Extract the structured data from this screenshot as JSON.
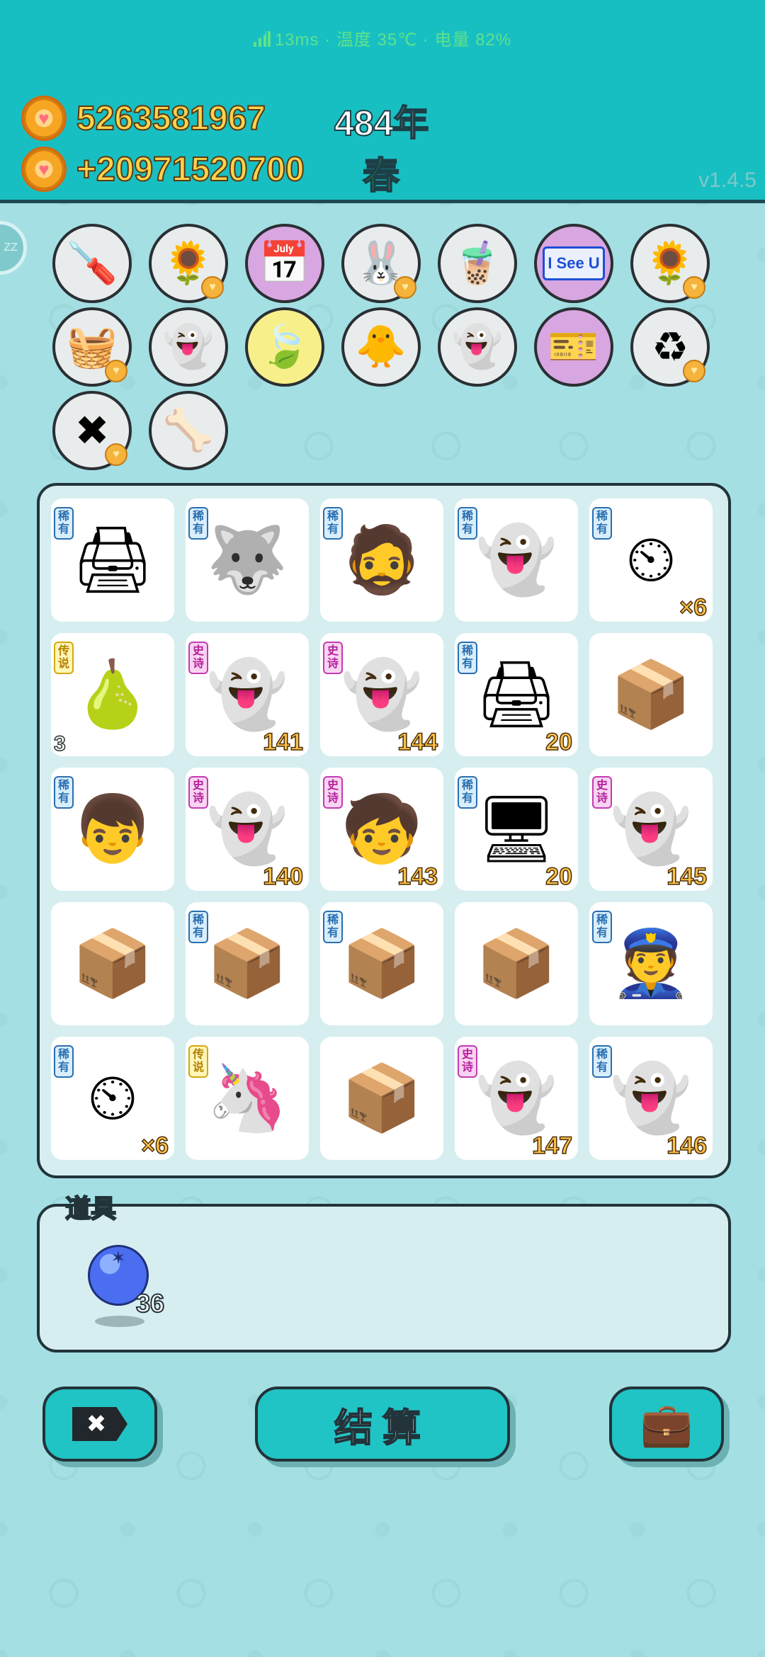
{
  "status": {
    "text": "13ms · 温度 35℃ · 电量 82%"
  },
  "header": {
    "coins": "5263581967",
    "income": "+20971520700",
    "year": "484年",
    "season": "春",
    "version": "v1.4.5"
  },
  "side_badge": {
    "text": "ZZ"
  },
  "colors": {
    "header": "#18bfc2",
    "accent_gold": "#ffc24a",
    "board_bg": "#d6eef0"
  },
  "strip_items": [
    {
      "icon": "screwdriver-icon",
      "glyph": "🪛",
      "style": "grey",
      "heart": false
    },
    {
      "icon": "sunflower-pair-icon",
      "glyph": "🌻",
      "style": "grey",
      "heart": true
    },
    {
      "icon": "calendar-icon",
      "glyph": "📅",
      "style": "purple",
      "heart": false
    },
    {
      "icon": "rabbit-icon",
      "glyph": "🐰",
      "style": "grey",
      "heart": true
    },
    {
      "icon": "bubble-tea-icon",
      "glyph": "🧋",
      "style": "grey",
      "heart": false
    },
    {
      "icon": "i-see-u-icon",
      "glyph": "I See U",
      "style": "purple",
      "heart": false
    },
    {
      "icon": "sunflower-pair-icon",
      "glyph": "🌻",
      "style": "grey",
      "heart": true
    },
    {
      "icon": "fruit-basket-icon",
      "glyph": "🧺",
      "style": "grey",
      "heart": true
    },
    {
      "icon": "ghost-wink-icon",
      "glyph": "👻",
      "style": "grey",
      "heart": false
    },
    {
      "icon": "leaf-icon",
      "glyph": "🍃",
      "style": "yellow",
      "heart": false
    },
    {
      "icon": "chick-egg-icon",
      "glyph": "🐥",
      "style": "grey",
      "heart": false
    },
    {
      "icon": "ghost-wink-icon",
      "glyph": "👻",
      "style": "grey",
      "heart": false
    },
    {
      "icon": "capsule-pack-icon",
      "glyph": "🎫",
      "style": "purple",
      "heart": false
    },
    {
      "icon": "recycle-icon",
      "glyph": "♻",
      "style": "grey",
      "heart": true
    },
    {
      "icon": "remove-tag-icon",
      "glyph": "✖",
      "style": "grey",
      "heart": true
    },
    {
      "icon": "pet-food-bowl-icon",
      "glyph": "🦴",
      "style": "grey",
      "heart": false
    }
  ],
  "rarity_labels": {
    "rare": "稀有",
    "legend": "传说",
    "epic": "史诗"
  },
  "board": [
    {
      "icon": "printer-icon",
      "glyph": "🖨",
      "rarity": "稀有",
      "rarity_kind": "rare",
      "count": ""
    },
    {
      "icon": "husky-dog-icon",
      "glyph": "🐺",
      "rarity": "稀有",
      "rarity_kind": "rare",
      "count": ""
    },
    {
      "icon": "bucket-hat-man-icon",
      "glyph": "🧔",
      "rarity": "稀有",
      "rarity_kind": "rare",
      "count": ""
    },
    {
      "icon": "ghost-x-eyes-icon",
      "glyph": "👻",
      "rarity": "稀有",
      "rarity_kind": "rare",
      "count": ""
    },
    {
      "icon": "speedometer-icon",
      "glyph": "⏲",
      "rarity": "稀有",
      "rarity_kind": "rare",
      "count": "×6"
    },
    {
      "icon": "pear-icon",
      "glyph": "🍐",
      "rarity": "传说",
      "rarity_kind": "legend",
      "count": "",
      "count_left": "3"
    },
    {
      "icon": "ghost-x-eyes-icon",
      "glyph": "👻",
      "rarity": "史诗",
      "rarity_kind": "epic",
      "count": "141"
    },
    {
      "icon": "ghost-x-eyes-icon",
      "glyph": "👻",
      "rarity": "史诗",
      "rarity_kind": "epic",
      "count": "144"
    },
    {
      "icon": "printer-icon",
      "glyph": "🖨",
      "rarity": "稀有",
      "rarity_kind": "rare",
      "count": "20"
    },
    {
      "icon": "cardboard-box-icon",
      "glyph": "📦",
      "rarity": "",
      "rarity_kind": "",
      "count": ""
    },
    {
      "icon": "glasses-boy-icon",
      "glyph": "👦",
      "rarity": "稀有",
      "rarity_kind": "rare",
      "count": ""
    },
    {
      "icon": "ghost-x-eyes-icon",
      "glyph": "👻",
      "rarity": "史诗",
      "rarity_kind": "epic",
      "count": "140"
    },
    {
      "icon": "red-cap-boy-icon",
      "glyph": "🧒",
      "rarity": "史诗",
      "rarity_kind": "epic",
      "count": "143"
    },
    {
      "icon": "computer-tower-icon",
      "glyph": "🖥",
      "rarity": "稀有",
      "rarity_kind": "rare",
      "count": "20"
    },
    {
      "icon": "ghost-x-eyes-icon",
      "glyph": "👻",
      "rarity": "史诗",
      "rarity_kind": "epic",
      "count": "145"
    },
    {
      "icon": "cardboard-box-icon",
      "glyph": "📦",
      "rarity": "",
      "rarity_kind": "",
      "count": ""
    },
    {
      "icon": "cardboard-box-icon",
      "glyph": "📦",
      "rarity": "稀有",
      "rarity_kind": "rare",
      "count": ""
    },
    {
      "icon": "cardboard-box-icon",
      "glyph": "📦",
      "rarity": "稀有",
      "rarity_kind": "rare",
      "count": ""
    },
    {
      "icon": "cardboard-box-icon",
      "glyph": "📦",
      "rarity": "",
      "rarity_kind": "",
      "count": ""
    },
    {
      "icon": "police-officer-icon",
      "glyph": "👮",
      "rarity": "稀有",
      "rarity_kind": "rare",
      "count": ""
    },
    {
      "icon": "speedometer-icon",
      "glyph": "⏲",
      "rarity": "稀有",
      "rarity_kind": "rare",
      "count": "×6"
    },
    {
      "icon": "unicorn-box-icon",
      "glyph": "🦄",
      "rarity": "传说",
      "rarity_kind": "legend",
      "count": ""
    },
    {
      "icon": "cardboard-box-icon",
      "glyph": "📦",
      "rarity": "",
      "rarity_kind": "",
      "count": ""
    },
    {
      "icon": "ghost-x-eyes-icon",
      "glyph": "👻",
      "rarity": "史诗",
      "rarity_kind": "epic",
      "count": "147"
    },
    {
      "icon": "ghost-x-eyes-icon",
      "glyph": "👻",
      "rarity": "稀有",
      "rarity_kind": "rare",
      "count": "146"
    }
  ],
  "props": {
    "title": "道具",
    "items": [
      {
        "icon": "blue-orb-icon",
        "count": "36"
      }
    ]
  },
  "buttons": {
    "remove": "✖",
    "settle": "结算",
    "bag_icon": "briefcase-icon"
  }
}
